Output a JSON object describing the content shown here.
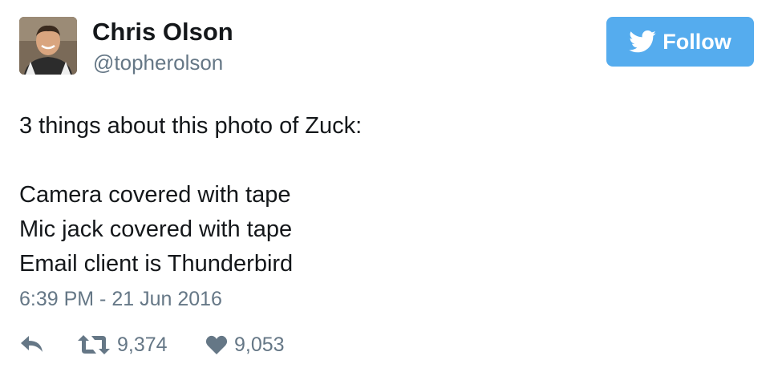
{
  "author": {
    "name": "Chris Olson",
    "handle": "@topherolson",
    "avatar_icon": "profile-photo"
  },
  "follow_button": {
    "label": "Follow",
    "icon": "twitter-bird-icon",
    "color": "#55acee"
  },
  "tweet": {
    "lines": [
      "3 things about this photo of Zuck:",
      "",
      "Camera covered with tape",
      "Mic jack covered with tape",
      "Email client is Thunderbird"
    ],
    "timestamp": "6:39 PM - 21 Jun 2016"
  },
  "actions": {
    "reply_icon": "reply-icon",
    "retweet_icon": "retweet-icon",
    "retweet_count": "9,374",
    "like_icon": "heart-icon",
    "like_count": "9,053"
  },
  "colors": {
    "text": "#14171a",
    "secondary": "#657786",
    "accent": "#55acee"
  }
}
